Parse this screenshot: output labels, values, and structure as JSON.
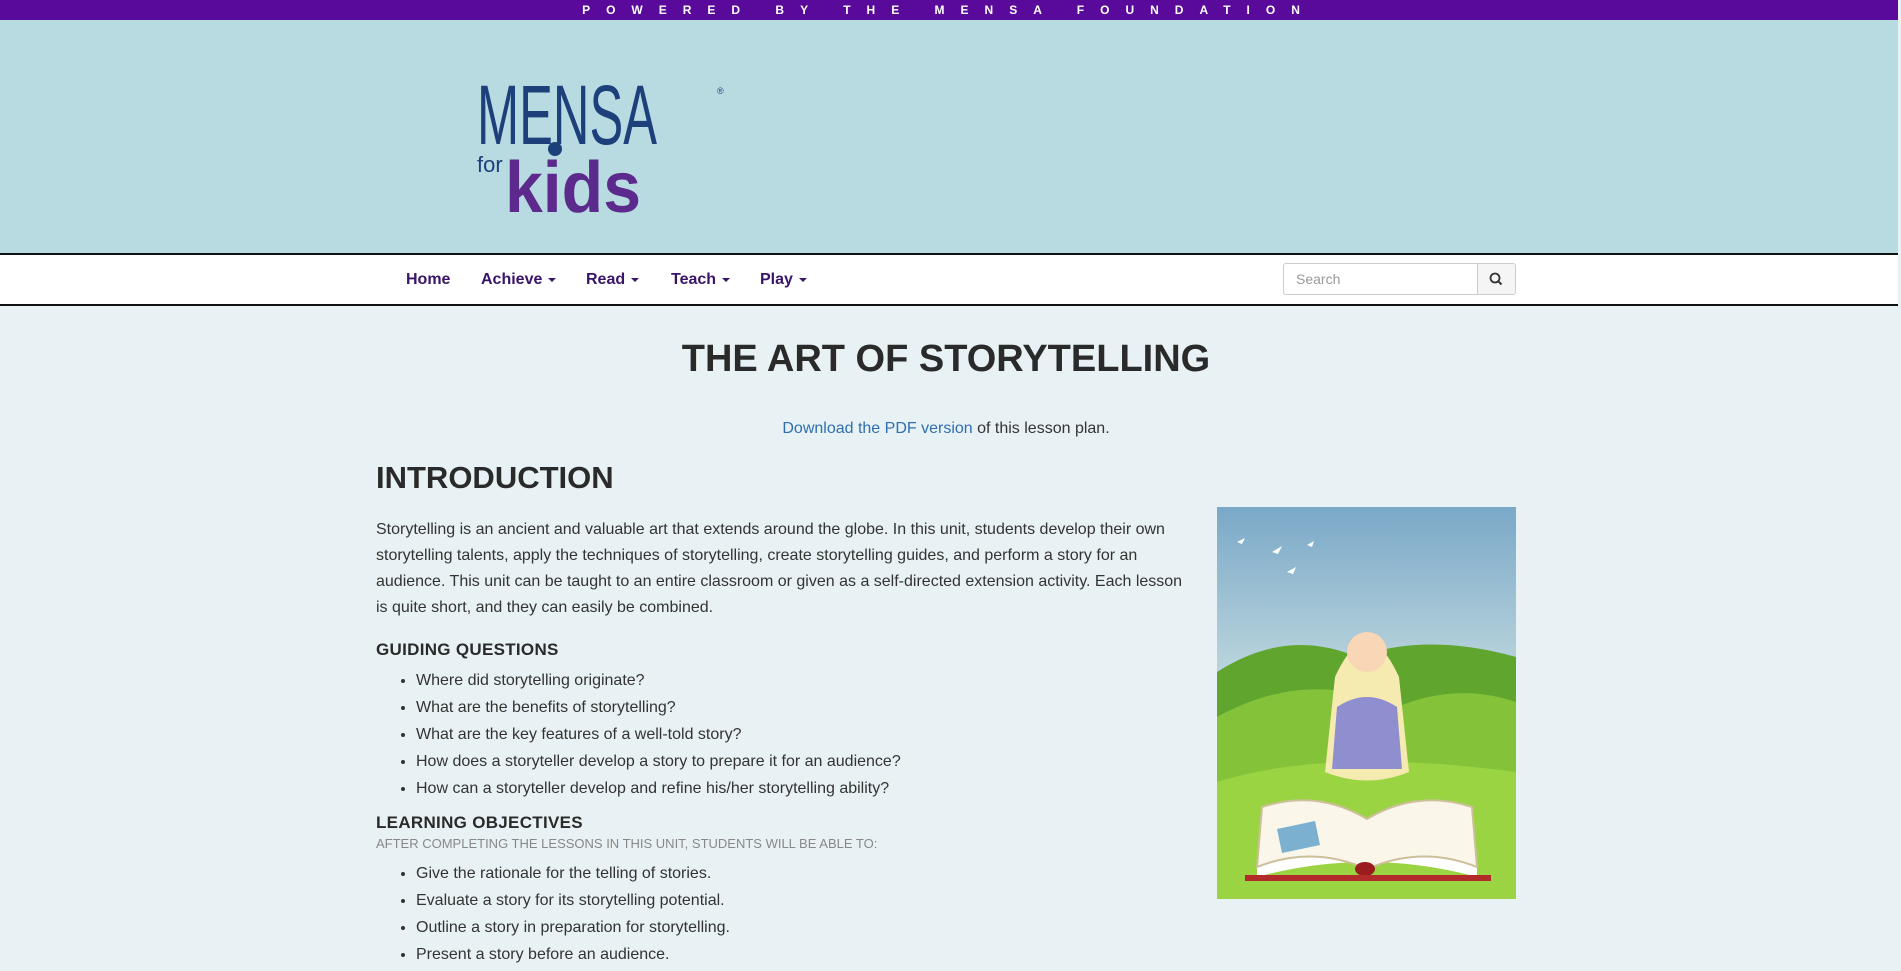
{
  "topbar": {
    "text": "POWERED BY THE MENSA FOUNDATION"
  },
  "logo": {
    "line1": "MENSA",
    "for": "for",
    "kids": "kids",
    "reg": "®"
  },
  "nav": {
    "items": [
      {
        "label": "Home",
        "dropdown": false
      },
      {
        "label": "Achieve",
        "dropdown": true
      },
      {
        "label": "Read",
        "dropdown": true
      },
      {
        "label": "Teach",
        "dropdown": true
      },
      {
        "label": "Play",
        "dropdown": true
      }
    ],
    "search_placeholder": "Search",
    "search_icon": "magnifier-icon"
  },
  "main": {
    "title": "THE ART OF STORYTELLING",
    "pdf_link": "Download the PDF version",
    "pdf_rest": " of this lesson plan.",
    "intro_heading": "INTRODUCTION",
    "intro_text": "Storytelling is an ancient and valuable art that extends around the globe. In this unit, students develop their own storytelling talents, apply the techniques of storytelling, create storytelling guides, and perform a story for an audience. This unit can be taught to an entire classroom or given as a self-directed extension activity. Each lesson is quite short, and they can easily be combined.",
    "guiding_heading": "GUIDING QUESTIONS",
    "guiding": [
      "Where did storytelling originate?",
      "What are the benefits of storytelling?",
      "What are the key features of a well-told story?",
      "How does a storyteller develop a story to prepare it for an audience?",
      "How can a storyteller develop and refine his/her storytelling ability?"
    ],
    "objectives_heading": "LEARNING OBJECTIVES",
    "objectives_sub": "AFTER COMPLETING THE LESSONS IN THIS UNIT, STUDENTS WILL BE ABLE TO:",
    "objectives": [
      "Give the rationale for the telling of stories.",
      "Evaluate a story for its storytelling potential.",
      "Outline a story in preparation for storytelling.",
      "Present a story before an audience."
    ]
  },
  "colors": {
    "topbar": "#5a0a9a",
    "header": "#b8dbe2",
    "page": "#e8f2f4",
    "nav_text": "#3a1468",
    "link": "#2f6fb0",
    "logo_blue": "#1d3f7a",
    "logo_purple": "#5b2a8c"
  }
}
